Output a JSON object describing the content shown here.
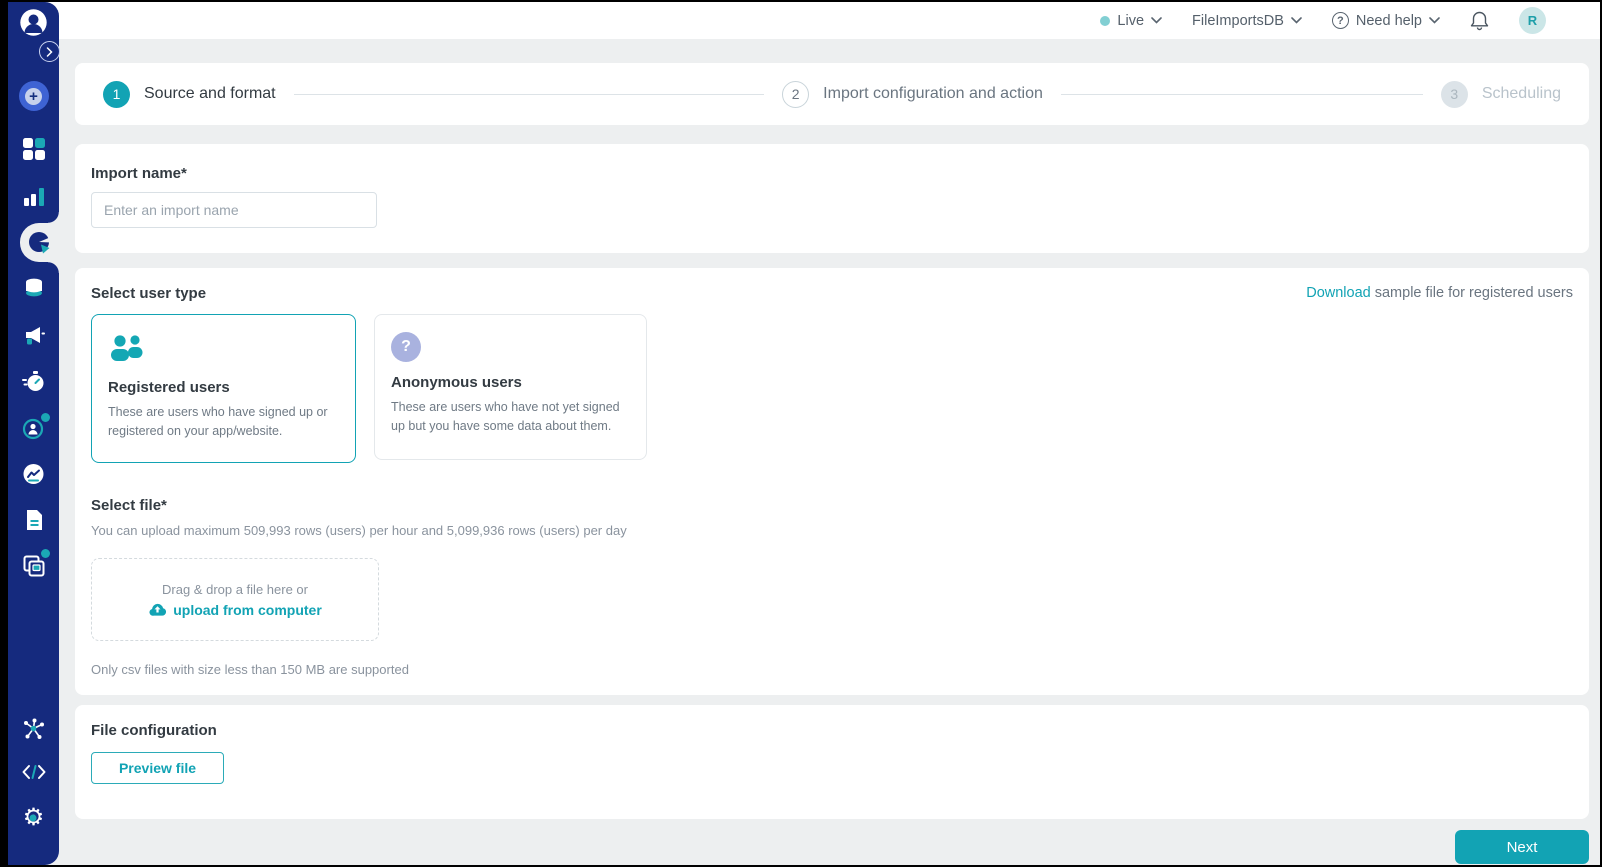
{
  "topbar": {
    "live_label": "Live",
    "project_name": "FileImportsDB",
    "help_label": "Need help",
    "avatar_initial": "R"
  },
  "stepper": {
    "steps": [
      {
        "num": "1",
        "label": "Source and format"
      },
      {
        "num": "2",
        "label": "Import configuration and action"
      },
      {
        "num": "3",
        "label": "Scheduling"
      }
    ]
  },
  "import_name": {
    "label": "Import name*",
    "placeholder": "Enter an import name"
  },
  "user_type": {
    "heading": "Select user type",
    "download_link": "Download",
    "download_rest": " sample file for registered users",
    "cards": [
      {
        "title": "Registered users",
        "desc": "These are users who have signed up or registered on your app/website."
      },
      {
        "title": "Anonymous users",
        "desc": "These are users who have not yet signed up but you have some data about them."
      }
    ]
  },
  "select_file": {
    "heading": "Select file*",
    "limit_note": "You can upload maximum 509,993 rows (users) per hour and 5,099,936 rows (users) per day",
    "drop_text": "Drag & drop a file here or",
    "upload_link": "upload from computer",
    "support_note": "Only csv files with size less than 150 MB are supported"
  },
  "file_config": {
    "heading": "File configuration",
    "preview_button": "Preview file"
  },
  "footer": {
    "next_button": "Next"
  },
  "colors": {
    "teal": "#12A3B4",
    "navy": "#152A7E",
    "lavender": "#A9B2DF",
    "sidebar_accent": "#1BA8B5"
  }
}
